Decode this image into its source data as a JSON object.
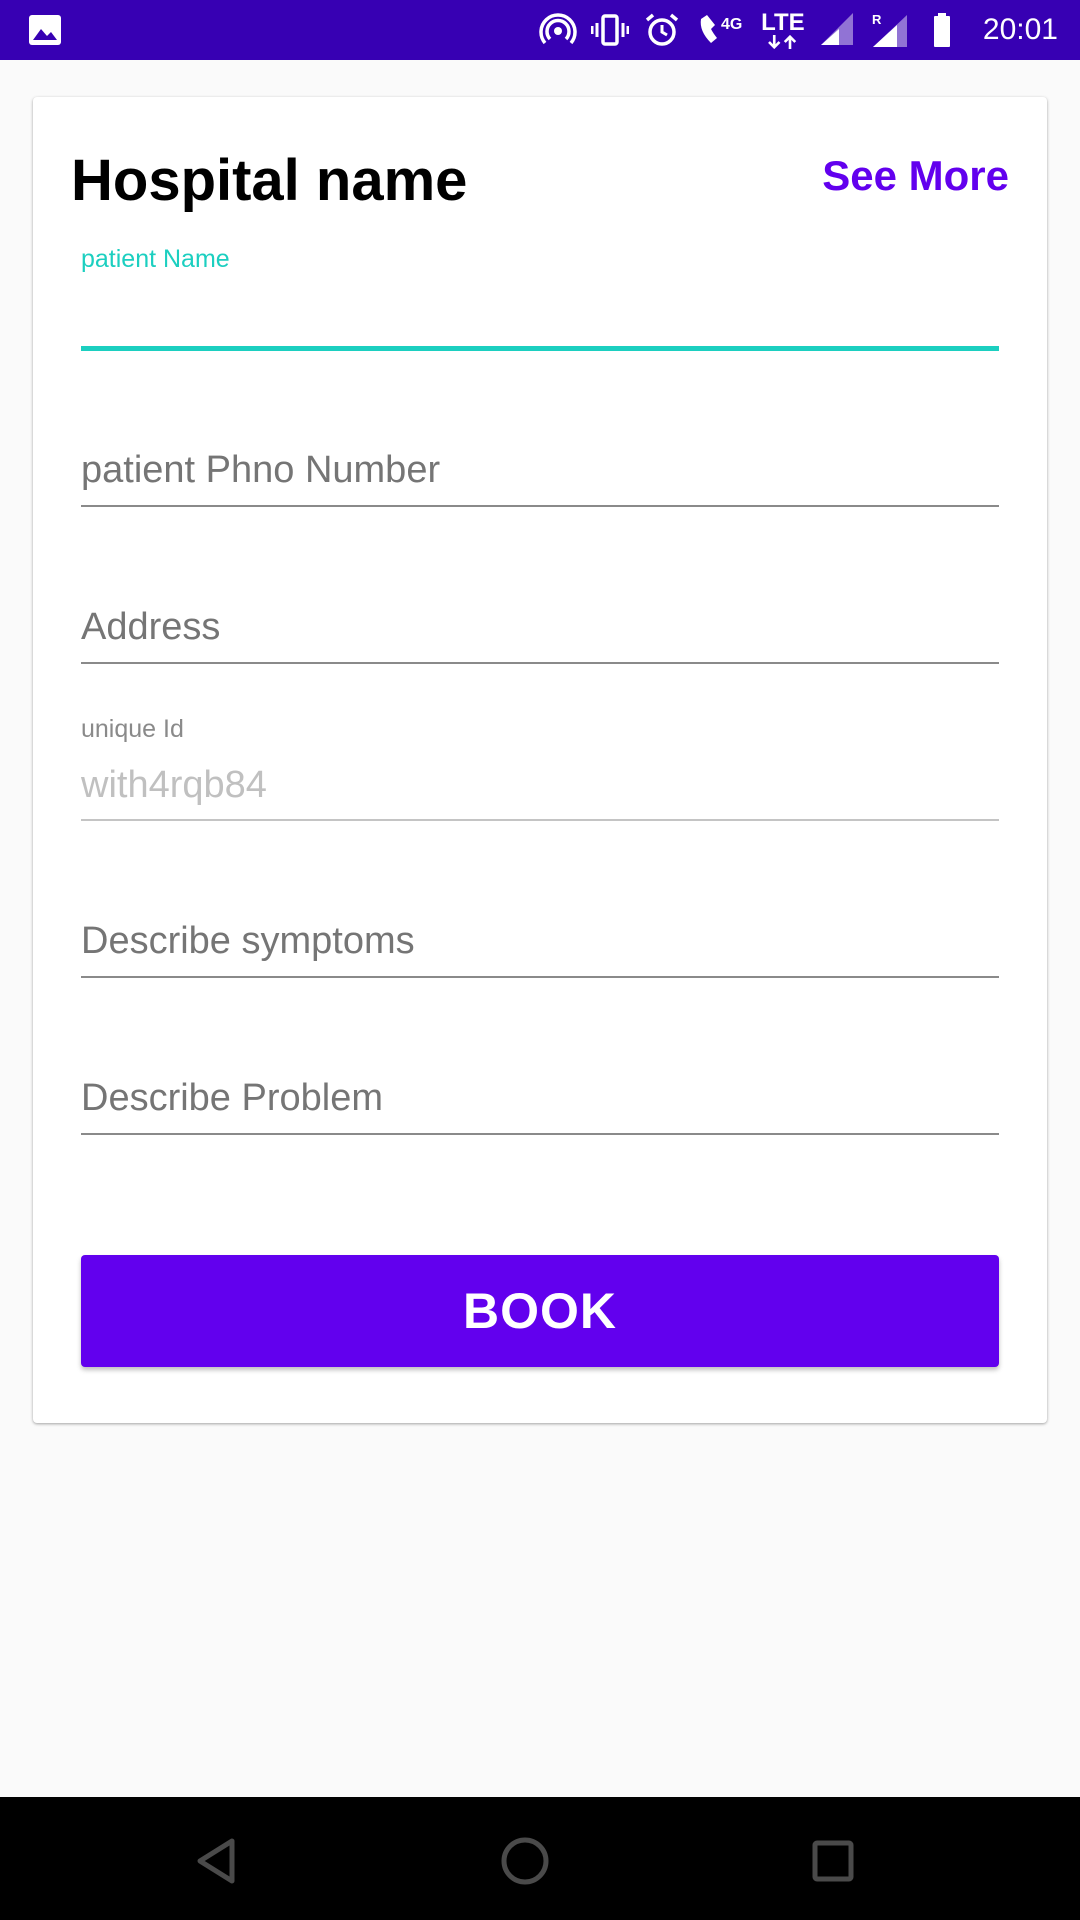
{
  "status_bar": {
    "time": "20:01",
    "network_4g": "4G",
    "network_lte": "LTE",
    "roaming": "R",
    "icons": [
      "image-icon",
      "hotspot-icon",
      "vibrate-icon",
      "alarm-icon",
      "wifi-call-icon",
      "signal-icon",
      "signal-roaming-icon",
      "battery-icon"
    ]
  },
  "card": {
    "title": "Hospital name",
    "see_more_label": "See More"
  },
  "form": {
    "patient_name": {
      "label": "patient Name",
      "value": ""
    },
    "patient_phone": {
      "placeholder": "patient Phno Number"
    },
    "address": {
      "placeholder": "Address"
    },
    "unique_id": {
      "label": "unique Id",
      "value": "with4rqb84"
    },
    "symptoms": {
      "placeholder": "Describe symptoms"
    },
    "problem": {
      "placeholder": "Describe Problem"
    }
  },
  "book_button_label": "BOOK",
  "nav_bar": {
    "icons": [
      "back-icon",
      "home-icon",
      "recents-icon"
    ]
  },
  "colors": {
    "status_bar": "#3700b3",
    "accent": "#6200ee",
    "focus": "#1ccfc0"
  }
}
